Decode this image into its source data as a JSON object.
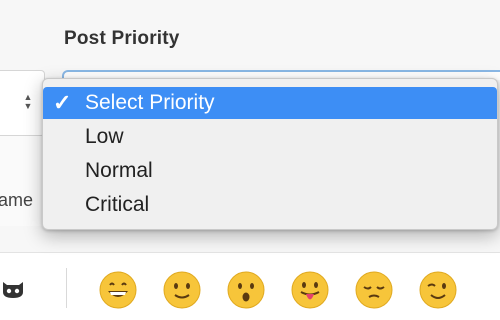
{
  "form": {
    "post_priority_label": "Post Priority",
    "name_label": "ame"
  },
  "priority_dropdown": {
    "selected_check": "✓",
    "options": [
      {
        "label": "Select Priority",
        "selected": true
      },
      {
        "label": "Low",
        "selected": false
      },
      {
        "label": "Normal",
        "selected": false
      },
      {
        "label": "Critical",
        "selected": false
      }
    ]
  },
  "emoji_bar": {
    "github_icon": "github-octocat-icon",
    "emojis": [
      "grinning-face-icon",
      "slightly-smiling-face-icon",
      "astonished-face-icon",
      "face-with-tongue-icon",
      "pensive-face-icon",
      "winking-face-icon"
    ]
  },
  "colors": {
    "selection_blue": "#3d8ef5",
    "focus_ring": "#8ab8e6",
    "emoji_yellow": "#f7c53a"
  }
}
